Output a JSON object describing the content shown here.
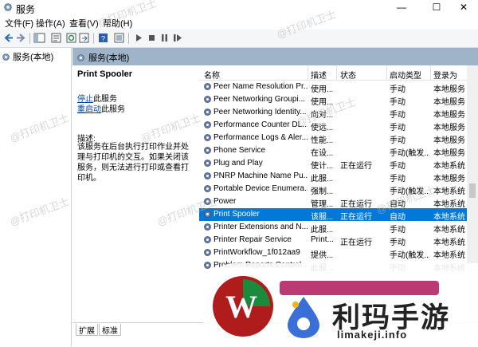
{
  "window": {
    "title": "服务",
    "min": "—",
    "max": "☐",
    "close": "✕"
  },
  "menu": {
    "items": [
      "文件(F)",
      "操作(A)",
      "查看(V)",
      "帮助(H)"
    ]
  },
  "tree": {
    "root": "服务(本地)"
  },
  "band": {
    "label": "服务(本地)"
  },
  "detail": {
    "service_name": "Print Spooler",
    "stop_link": "停止",
    "stop_suffix": "此服务",
    "restart_link": "重启动",
    "restart_suffix": "此服务",
    "desc_label": "描述:",
    "desc_text": "该服务在后台执行打印作业并处理与打印机的交互。如果关闭该服务，则无法进行打印或查看打印机。"
  },
  "list": {
    "columns": [
      "名称",
      "描述",
      "状态",
      "启动类型",
      "登录为"
    ],
    "rows": [
      {
        "name": "Peer Name Resolution Pr...",
        "desc": "使用...",
        "status": "",
        "startup": "手动",
        "logon": "本地服务"
      },
      {
        "name": "Peer Networking Groupi...",
        "desc": "使用...",
        "status": "",
        "startup": "手动",
        "logon": "本地服务"
      },
      {
        "name": "Peer Networking Identity...",
        "desc": "向对...",
        "status": "",
        "startup": "手动",
        "logon": "本地服务"
      },
      {
        "name": "Performance Counter DL...",
        "desc": "使远...",
        "status": "",
        "startup": "手动",
        "logon": "本地服务"
      },
      {
        "name": "Performance Logs & Aler...",
        "desc": "性能...",
        "status": "",
        "startup": "手动",
        "logon": "本地服务"
      },
      {
        "name": "Phone Service",
        "desc": "在设...",
        "status": "",
        "startup": "手动(触发...",
        "logon": "本地服务"
      },
      {
        "name": "Plug and Play",
        "desc": "使计...",
        "status": "正在运行",
        "startup": "手动",
        "logon": "本地系统"
      },
      {
        "name": "PNRP Machine Name Pu...",
        "desc": "此服...",
        "status": "",
        "startup": "手动",
        "logon": "本地服务"
      },
      {
        "name": "Portable Device Enumera...",
        "desc": "强制...",
        "status": "",
        "startup": "手动(触发...",
        "logon": "本地系统"
      },
      {
        "name": "Power",
        "desc": "管理...",
        "status": "正在运行",
        "startup": "自动",
        "logon": "本地系统"
      },
      {
        "name": "Print Spooler",
        "desc": "该服...",
        "status": "正在运行",
        "startup": "自动",
        "logon": "本地系统",
        "selected": true
      },
      {
        "name": "Printer Extensions and N...",
        "desc": "此服...",
        "status": "",
        "startup": "手动",
        "logon": "本地系统"
      },
      {
        "name": "Printer Repair Service",
        "desc": "Print...",
        "status": "正在运行",
        "startup": "手动",
        "logon": "本地系统"
      },
      {
        "name": "PrintWorkflow_1f012aa9",
        "desc": "提供...",
        "status": "",
        "startup": "手动(触发...",
        "logon": "本地系统"
      },
      {
        "name": "Problem Reports Control...",
        "desc": "此服...",
        "status": "",
        "startup": "手动",
        "logon": "本地系统"
      }
    ]
  },
  "tabs": [
    "扩展",
    "标准"
  ],
  "watermark": {
    "text": "@打印机卫士"
  },
  "logo": {
    "brand": "利玛手游",
    "url": "limakeji.info"
  },
  "colors": {
    "selection": "#0078d7",
    "band": "#9fb3c9",
    "gear": "#6a7fa0"
  }
}
